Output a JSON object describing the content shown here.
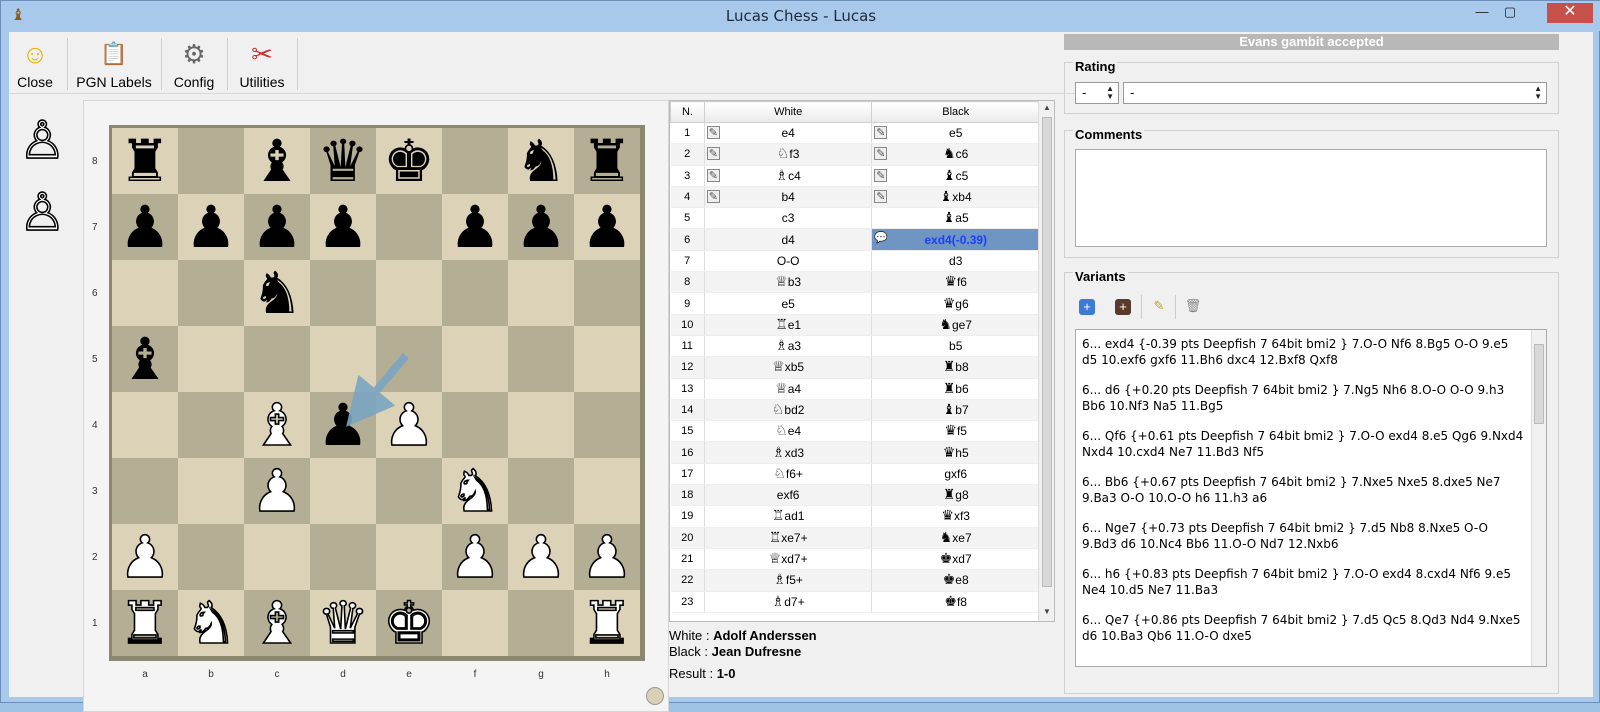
{
  "window": {
    "title": "Lucas Chess - Lucas",
    "minimize": "—",
    "maximize": "▢",
    "close": "✕",
    "app_icon": "♝"
  },
  "toolbar": {
    "items": [
      {
        "label": "Close",
        "icon": "person-icon",
        "glyph": "☺"
      },
      {
        "label": "PGN Labels",
        "icon": "pgn-labels-icon",
        "glyph": "📋"
      },
      {
        "label": "Config",
        "icon": "gear-icon",
        "glyph": "⚙"
      },
      {
        "label": "Utilities",
        "icon": "tools-icon",
        "glyph": "✂"
      }
    ]
  },
  "captured": {
    "pieces": [
      "♙",
      "♙"
    ]
  },
  "board": {
    "ranks": [
      "8",
      "7",
      "6",
      "5",
      "4",
      "3",
      "2",
      "1"
    ],
    "files": [
      "a",
      "b",
      "c",
      "d",
      "e",
      "f",
      "g",
      "h"
    ],
    "position": [
      [
        "r",
        "",
        "b",
        "q",
        "k",
        "",
        "n",
        "r"
      ],
      [
        "p",
        "p",
        "p",
        "p",
        "",
        "p",
        "p",
        "p"
      ],
      [
        "",
        "",
        "n",
        "",
        "",
        "",
        "",
        ""
      ],
      [
        "b",
        "",
        "",
        "",
        "",
        "",
        "",
        ""
      ],
      [
        "",
        "",
        "B",
        "p",
        "P",
        "",
        "",
        ""
      ],
      [
        "",
        "",
        "P",
        "",
        "",
        "N",
        "",
        ""
      ],
      [
        "P",
        "",
        "",
        "",
        "",
        "P",
        "P",
        "P"
      ],
      [
        "R",
        "N",
        "B",
        "Q",
        "K",
        "",
        "",
        "R"
      ]
    ],
    "last_move_arrow": {
      "from": "e5",
      "to": "d4",
      "color": "#7aa6c2"
    }
  },
  "moves": {
    "headers": {
      "num": "N.",
      "white": "White",
      "black": "Black"
    },
    "rows": [
      {
        "n": "1",
        "w": "e4",
        "wp": "",
        "b": "e5",
        "bp": "",
        "wnote": true,
        "bnote": true
      },
      {
        "n": "2",
        "w": "f3",
        "wp": "♘",
        "b": "c6",
        "bp": "♞",
        "wnote": true,
        "bnote": true
      },
      {
        "n": "3",
        "w": "c4",
        "wp": "♗",
        "b": "c5",
        "bp": "♝",
        "wnote": true,
        "bnote": true
      },
      {
        "n": "4",
        "w": "b4",
        "wp": "",
        "b": "xb4",
        "bp": "♝",
        "wnote": true,
        "bnote": true
      },
      {
        "n": "5",
        "w": "c3",
        "wp": "",
        "b": "a5",
        "bp": "♝"
      },
      {
        "n": "6",
        "w": "d4",
        "wp": "",
        "b": "exd4(-0.39)",
        "bp": "",
        "selected": true,
        "bcomment": true
      },
      {
        "n": "7",
        "w": "O-O",
        "wp": "",
        "b": "d3",
        "bp": ""
      },
      {
        "n": "8",
        "w": "b3",
        "wp": "♕",
        "b": "f6",
        "bp": "♛"
      },
      {
        "n": "9",
        "w": "e5",
        "wp": "",
        "b": "g6",
        "bp": "♛"
      },
      {
        "n": "10",
        "w": "e1",
        "wp": "♖",
        "b": "ge7",
        "bp": "♞"
      },
      {
        "n": "11",
        "w": "a3",
        "wp": "♗",
        "b": "b5",
        "bp": ""
      },
      {
        "n": "12",
        "w": "xb5",
        "wp": "♕",
        "b": "b8",
        "bp": "♜"
      },
      {
        "n": "13",
        "w": "a4",
        "wp": "♕",
        "b": "b6",
        "bp": "♜"
      },
      {
        "n": "14",
        "w": "bd2",
        "wp": "♘",
        "b": "b7",
        "bp": "♝"
      },
      {
        "n": "15",
        "w": "e4",
        "wp": "♘",
        "b": "f5",
        "bp": "♛"
      },
      {
        "n": "16",
        "w": "xd3",
        "wp": "♗",
        "b": "h5",
        "bp": "♛"
      },
      {
        "n": "17",
        "w": "f6+",
        "wp": "♘",
        "b": "gxf6",
        "bp": ""
      },
      {
        "n": "18",
        "w": "exf6",
        "wp": "",
        "b": "g8",
        "bp": "♜"
      },
      {
        "n": "19",
        "w": "ad1",
        "wp": "♖",
        "b": "xf3",
        "bp": "♛"
      },
      {
        "n": "20",
        "w": "xe7+",
        "wp": "♖",
        "b": "xe7",
        "bp": "♞"
      },
      {
        "n": "21",
        "w": "xd7+",
        "wp": "♕",
        "b": "xd7",
        "bp": "♚"
      },
      {
        "n": "22",
        "w": "f5+",
        "wp": "♗",
        "b": "e8",
        "bp": "♚"
      },
      {
        "n": "23",
        "w": "d7+",
        "wp": "♗",
        "b": "f8",
        "bp": "♚"
      }
    ]
  },
  "game_info": {
    "white_label": "White : ",
    "white": "Adolf Anderssen",
    "black_label": "Black : ",
    "black": "Jean Dufresne",
    "result_label": "Result : ",
    "result": "1-0"
  },
  "right": {
    "opening": "Evans gambit accepted",
    "rating_title": "Rating",
    "rating_spin": "-",
    "rating_combo": "-",
    "comments_title": "Comments",
    "variants_title": "Variants",
    "variants": [
      "6... exd4 {-0.39 pts Deepfish 7 64bit bmi2 } 7.O-O Nf6 8.Bg5 O-O 9.e5 d5 10.exf6 gxf6 11.Bh6 dxc4 12.Bxf8 Qxf8",
      "6... d6 {+0.20 pts Deepfish 7 64bit bmi2 } 7.Ng5 Nh6 8.O-O O-O 9.h3 Bb6 10.Nf3 Na5 11.Bg5",
      "6... Qf6 {+0.61 pts Deepfish 7 64bit bmi2 } 7.O-O exd4 8.e5 Qg6 9.Nxd4 Nxd4 10.cxd4 Ne7 11.Bd3 Nf5",
      "6... Bb6 {+0.67 pts Deepfish 7 64bit bmi2 } 7.Nxe5 Nxe5 8.dxe5 Ne7 9.Ba3 O-O 10.O-O h6 11.h3 a6",
      "6... Nge7 {+0.73 pts Deepfish 7 64bit bmi2 } 7.d5 Nb8 8.Nxe5 O-O 9.Bd3 d6 10.Nc4 Bb6 11.O-O Nd7 12.Nxb6",
      "6... h6 {+0.83 pts Deepfish 7 64bit bmi2 } 7.O-O exd4 8.cxd4 Nf6 9.e5 Ne4 10.d5 Ne7 11.Ba3",
      "6... Qe7 {+0.86 pts Deepfish 7 64bit bmi2 } 7.d5 Qc5 8.Qd3 Nd4 9.Nxe5 d6 10.Ba3 Qb6 11.O-O dxe5"
    ]
  }
}
